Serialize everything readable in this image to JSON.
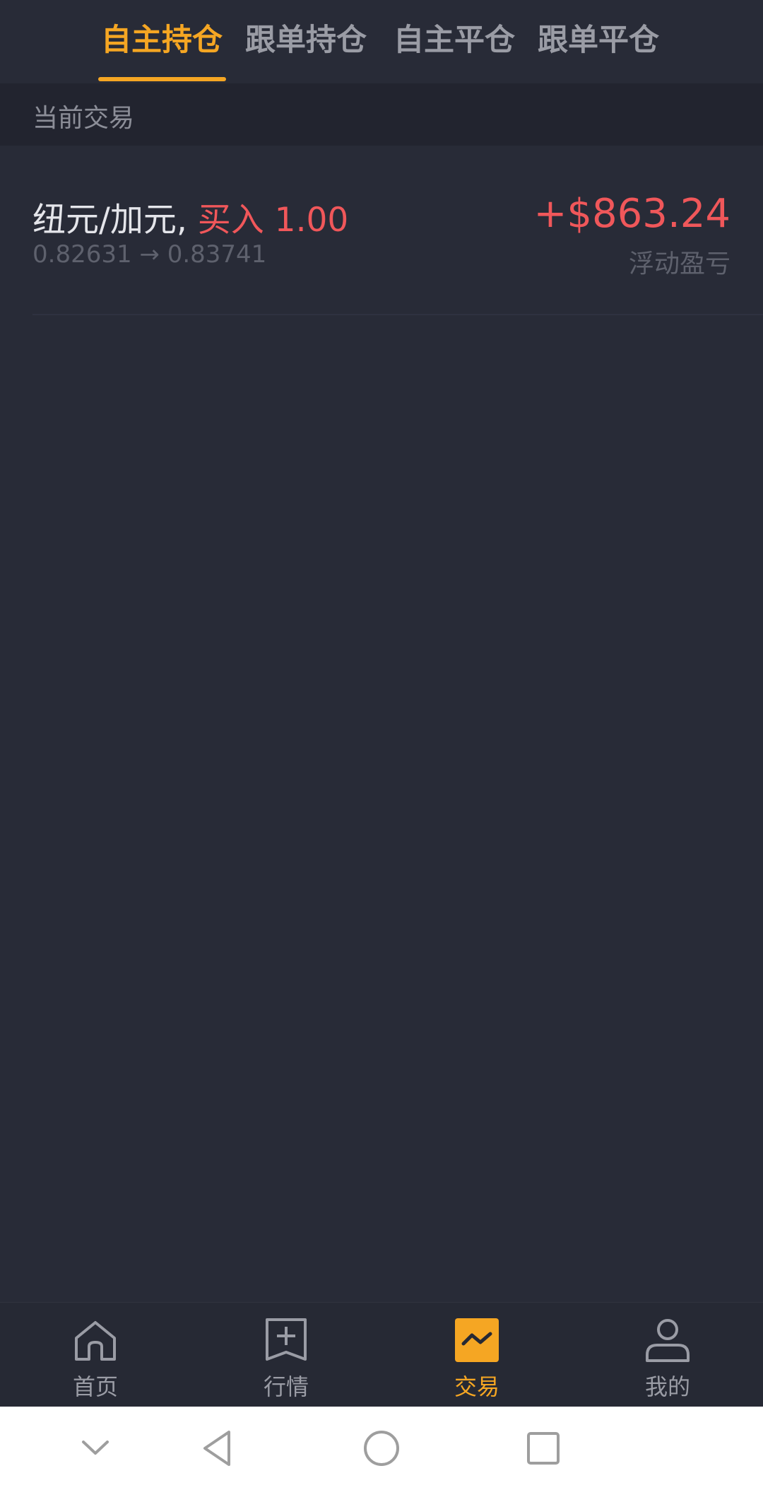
{
  "top_tabs": [
    {
      "label": "自主持仓",
      "active": true
    },
    {
      "label": "跟单持仓",
      "active": false
    },
    {
      "label": "自主平仓",
      "active": false
    },
    {
      "label": "跟单平仓",
      "active": false
    }
  ],
  "section": {
    "title": "当前交易"
  },
  "trades": [
    {
      "pair": "纽元/加元,",
      "direction": "买入 1.00",
      "prices": "0.82631 → 0.83741",
      "pnl": "+$863.24",
      "pnl_label": "浮动盈亏"
    }
  ],
  "bottom_nav": [
    {
      "label": "首页",
      "icon": "home-icon",
      "active": false
    },
    {
      "label": "行情",
      "icon": "market-icon",
      "active": false
    },
    {
      "label": "交易",
      "icon": "trade-icon",
      "active": true
    },
    {
      "label": "我的",
      "icon": "user-icon",
      "active": false
    }
  ],
  "system_nav": [
    {
      "icon": "chevron-down-icon"
    },
    {
      "icon": "back-triangle-icon"
    },
    {
      "icon": "home-circle-icon"
    },
    {
      "icon": "recents-square-icon"
    }
  ],
  "colors": {
    "background": "#282b37",
    "accent": "#f5a623",
    "loss_gain_red": "#f0575a",
    "muted_text": "#9a9ca5"
  }
}
